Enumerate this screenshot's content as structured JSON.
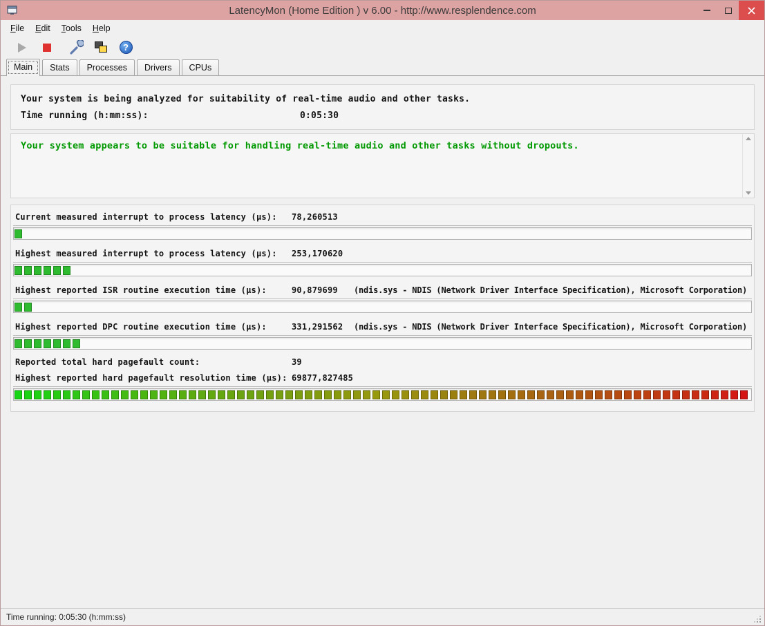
{
  "window": {
    "title": "LatencyMon  (Home Edition )  v 6.00 - http://www.resplendence.com"
  },
  "menu": {
    "items": [
      "File",
      "Edit",
      "Tools",
      "Help"
    ]
  },
  "toolbar": {
    "buttons": [
      "play",
      "stop",
      "tools",
      "processes",
      "help"
    ],
    "help_glyph": "?"
  },
  "tabs": {
    "labels": [
      "Main",
      "Stats",
      "Processes",
      "Drivers",
      "CPUs"
    ],
    "active": "Main"
  },
  "analysis": {
    "status_line": "Your system is being analyzed for suitability of real-time audio and other tasks.",
    "time_label": "Time running (h:mm:ss):",
    "time_value": "0:05:30"
  },
  "report": {
    "message": "Your system appears to be suitable for handling real-time audio and other tasks without dropouts."
  },
  "metrics": [
    {
      "label": "Current measured interrupt to process latency (µs):",
      "value": "78,260513",
      "extra": "",
      "bar": {
        "style": "green",
        "filled": 1,
        "total": 76
      }
    },
    {
      "label": "Highest measured interrupt to process latency (µs):",
      "value": "253,170620",
      "extra": "",
      "bar": {
        "style": "green",
        "filled": 6,
        "total": 76
      }
    },
    {
      "label": "Highest reported ISR routine execution time (µs):",
      "value": "90,879699",
      "extra": "(ndis.sys - NDIS (Network Driver Interface Specification), Microsoft Corporation)",
      "bar": {
        "style": "green",
        "filled": 2,
        "total": 76
      }
    },
    {
      "label": "Highest reported DPC routine execution time (µs):",
      "value": "331,291562",
      "extra": "(ndis.sys - NDIS (Network Driver Interface Specification), Microsoft Corporation)",
      "bar": {
        "style": "green",
        "filled": 7,
        "total": 76
      }
    },
    {
      "label": "Reported total hard pagefault count:",
      "value": "39",
      "extra": "",
      "bar": null
    },
    {
      "label": "Highest reported hard pagefault resolution time (µs):",
      "value": "69877,827485",
      "extra": "",
      "bar": {
        "style": "gradient",
        "filled": 76,
        "total": 76
      }
    }
  ],
  "status_bar": {
    "text": "Time running: 0:05:30  (h:mm:ss)"
  },
  "colors": {
    "titlebar_bg": "#dda2a2",
    "close_button_bg": "#dc4e4e",
    "report_text": "#009900",
    "bar_green": "#2fbb2f"
  }
}
